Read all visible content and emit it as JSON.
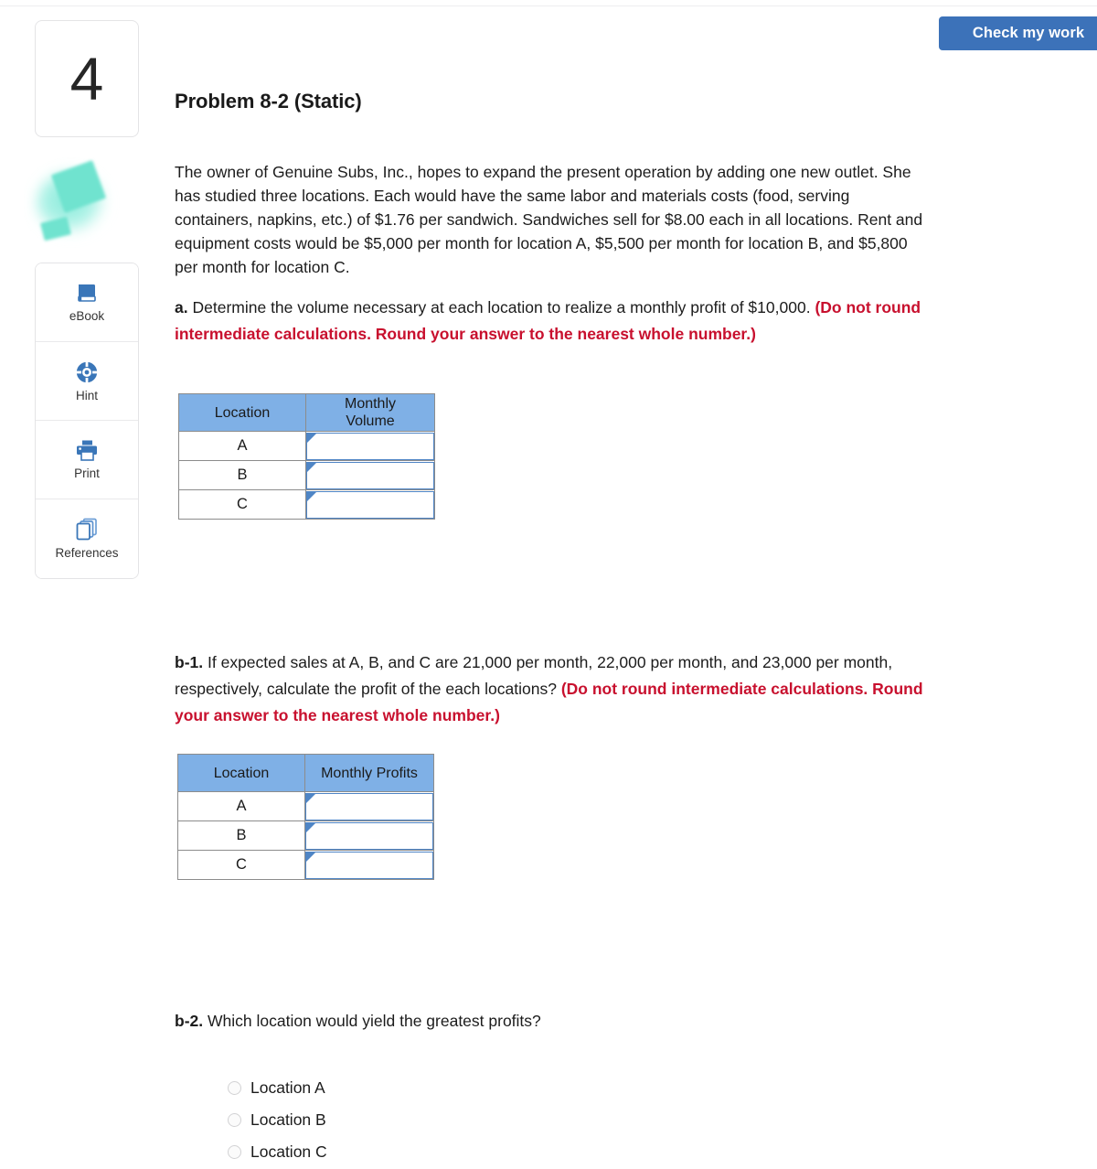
{
  "topbar": {
    "check_my_work_label": "Check my work"
  },
  "rail": {
    "question_number": "4",
    "decorative_icon": "mint-blob-graphic",
    "tools": [
      {
        "label": "eBook",
        "icon": "book-icon"
      },
      {
        "label": "Hint",
        "icon": "lifebuoy-icon"
      },
      {
        "label": "Print",
        "icon": "printer-icon"
      },
      {
        "label": "References",
        "icon": "stacked-pages-icon"
      }
    ]
  },
  "problem": {
    "title": "Problem 8-2 (Static)",
    "body_lines": [
      "The owner of Genuine Subs, Inc., hopes to expand the present operation by adding one new outlet. She",
      "has studied three locations. Each would have the same labor and materials costs (food, serving",
      "containers, napkins, etc.) of $1.76 per sandwich. Sandwiches sell for $8.00 each in all locations. Rent and",
      "equipment costs would be $5,000 per month for location A, $5,500 per month for location B, and $5,800",
      "per month for location C."
    ]
  },
  "part_a": {
    "label": "a.",
    "question": "Determine the volume necessary at each location to realize a monthly profit of $10,000.",
    "instruction_line_1": "(Do not round",
    "instruction_line_2": "intermediate calculations. Round your answer to the nearest whole number.)",
    "table": {
      "headers": [
        "Location",
        "Monthly Volume"
      ],
      "header_monthly_line1": "Monthly",
      "header_monthly_line2": "Volume",
      "rows": [
        {
          "location": "A",
          "value": "",
          "placeholder": ""
        },
        {
          "location": "B",
          "value": "",
          "placeholder": ""
        },
        {
          "location": "C",
          "value": "",
          "placeholder": ""
        }
      ]
    }
  },
  "part_b1": {
    "label": "b-1.",
    "question_line_1": "If expected sales at A, B, and C are 21,000 per month, 22,000 per month, and 23,000 per month,",
    "question_line_2": "respectively, calculate the profit of the each locations?",
    "instruction_line_1": "(Do not round intermediate calculations. Round",
    "instruction_line_2": "your answer to the nearest whole number.)",
    "table": {
      "headers": [
        "Location",
        "Monthly Profits"
      ],
      "rows": [
        {
          "location": "A",
          "value": "",
          "placeholder": ""
        },
        {
          "location": "B",
          "value": "",
          "placeholder": ""
        },
        {
          "location": "C",
          "value": "",
          "placeholder": ""
        }
      ]
    }
  },
  "part_b2": {
    "label": "b-2.",
    "question": "Which location would yield the greatest profits?",
    "options": [
      {
        "label": "Location A",
        "selected": false
      },
      {
        "label": "Location B",
        "selected": false
      },
      {
        "label": "Location C",
        "selected": false
      }
    ]
  },
  "colors": {
    "button_blue": "#3c72b9",
    "table_header_blue": "#7fb0e6",
    "input_border_blue": "#4f85c5",
    "instruction_red": "#c8102e",
    "icon_blue": "#3a76b8",
    "decorative_mint": "#6fe3cf"
  }
}
